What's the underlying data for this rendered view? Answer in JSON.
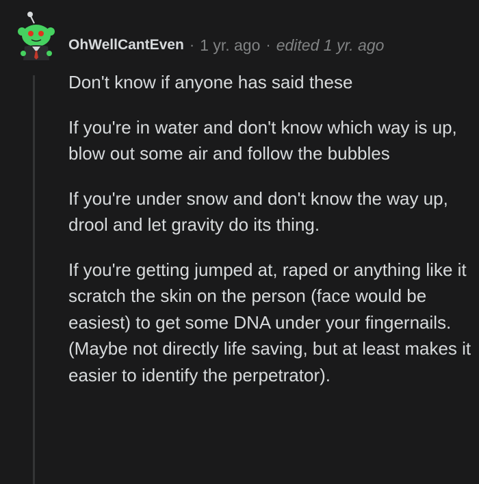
{
  "comment": {
    "author": "OhWellCantEven",
    "separator": "·",
    "time": "1 yr. ago",
    "edited": "edited 1 yr. ago",
    "paragraphs": [
      "Don't know if anyone has said these",
      "If you're in water and don't know which way is up, blow out some air and follow the bubbles",
      "If you're under snow and don't know the way up, drool and let gravity do its thing.",
      "If you're getting jumped at, raped or anything like it scratch the skin on the person (face would be easiest) to get some DNA under your fingernails. (Maybe not directly life saving, but at least makes it easier to identify the perpetrator)."
    ]
  },
  "colors": {
    "background": "#1a1a1b",
    "text": "#d7dadc",
    "meta": "#818384",
    "thread_line": "#343536",
    "avatar_green": "#46d160"
  },
  "icons": {
    "avatar": "snoo-avatar-icon"
  }
}
